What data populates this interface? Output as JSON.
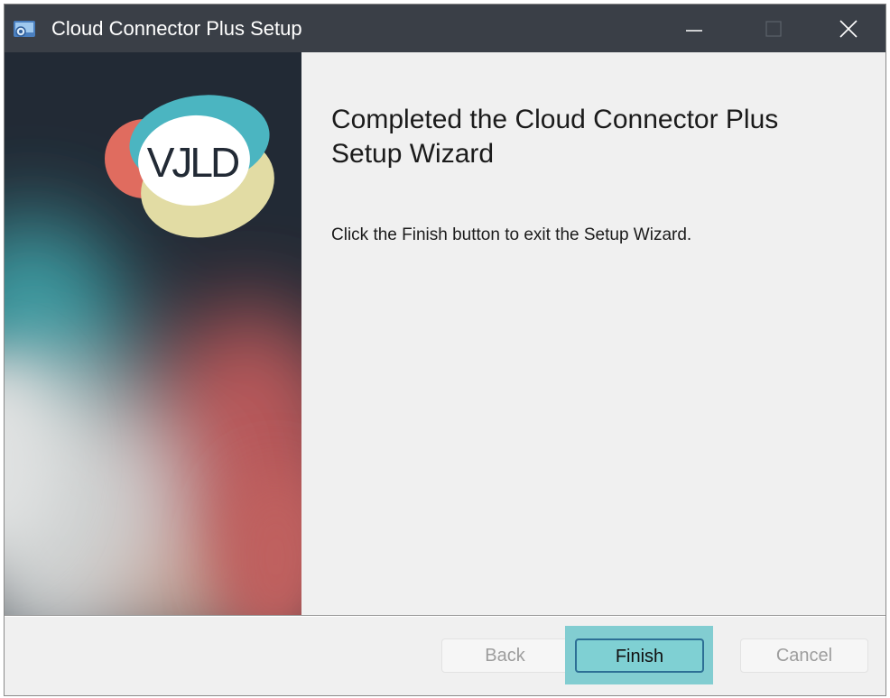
{
  "window": {
    "title": "Cloud Connector Plus Setup",
    "app_icon": "setup-app-icon"
  },
  "titlebar_controls": {
    "minimize_icon": "minimize-icon",
    "maximize_icon": "maximize-icon",
    "close_icon": "close-icon"
  },
  "banner": {
    "logo_text": "VJLD"
  },
  "main": {
    "heading": "Completed the Cloud Connector Plus Setup Wizard",
    "body": "Click the Finish button to exit the Setup Wizard."
  },
  "footer": {
    "back_label": "Back",
    "finish_label": "Finish",
    "cancel_label": "Cancel",
    "back_enabled": false,
    "cancel_enabled": false
  },
  "colors": {
    "titlebar": "#3a3f47",
    "accent_teal": "#7fd0d3",
    "focus_border": "#2d6f95",
    "disabled_text": "#9d9d9d"
  }
}
